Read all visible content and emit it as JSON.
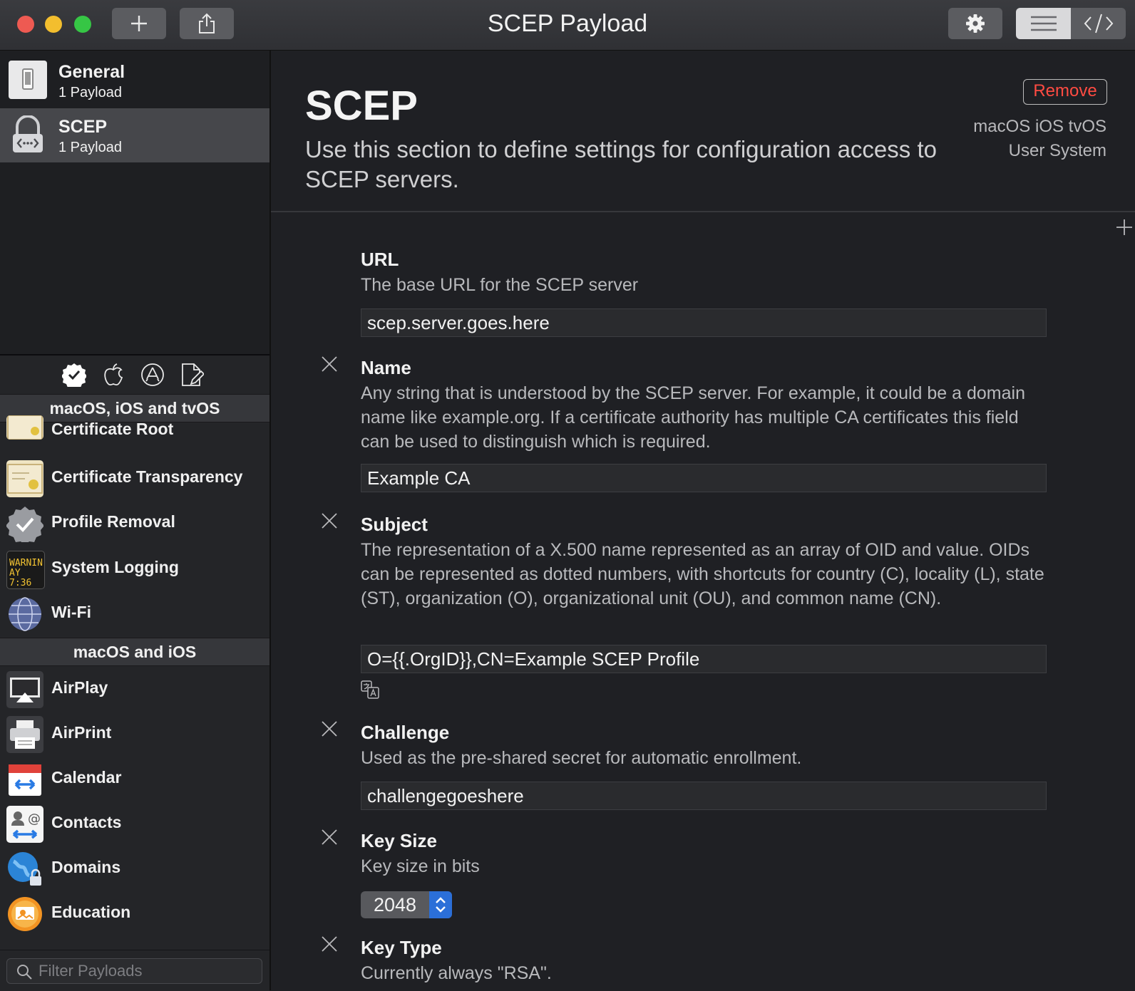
{
  "window": {
    "title": "SCEP Payload"
  },
  "toolbar": {
    "icons": [
      "plus-icon",
      "share-icon",
      "gear-icon",
      "list-view-icon",
      "code-view-icon"
    ]
  },
  "sidebar": {
    "payloads": [
      {
        "title": "General",
        "subtitle": "1 Payload",
        "icon": "device-icon",
        "selected": false
      },
      {
        "title": "SCEP",
        "subtitle": "1 Payload",
        "icon": "scep-lock-icon",
        "selected": true
      }
    ],
    "filter_icons": [
      "checkmark-badge-icon",
      "apple-icon",
      "app-store-icon",
      "document-edit-icon"
    ],
    "groups": [
      {
        "header": "macOS, iOS and tvOS",
        "items": [
          {
            "label": "Certificate Root",
            "icon": "certificate-icon"
          },
          {
            "label": "Certificate Transparency",
            "icon": "certificate-icon"
          },
          {
            "label": "Profile Removal",
            "icon": "badge-check-icon"
          },
          {
            "label": "System Logging",
            "icon": "console-log-icon"
          },
          {
            "label": "Wi-Fi",
            "icon": "globe-icon"
          }
        ]
      },
      {
        "header": "macOS and iOS",
        "items": [
          {
            "label": "AirPlay",
            "icon": "airplay-icon"
          },
          {
            "label": "AirPrint",
            "icon": "printer-icon"
          },
          {
            "label": "Calendar",
            "icon": "calendar-icon"
          },
          {
            "label": "Contacts",
            "icon": "contacts-icon"
          },
          {
            "label": "Domains",
            "icon": "globe-lock-icon"
          },
          {
            "label": "Education",
            "icon": "education-icon"
          }
        ]
      }
    ],
    "console_icon_text": [
      "WARNIN",
      "AY 7:36"
    ],
    "search": {
      "placeholder": "Filter Payloads"
    }
  },
  "main": {
    "title": "SCEP",
    "description": "Use this section to define settings for configuration access to SCEP servers.",
    "remove_label": "Remove",
    "platforms": "macOS iOS tvOS",
    "scope": "User System",
    "fields": [
      {
        "title": "URL",
        "description": "The base URL for the SCEP server",
        "value": "scep.server.goes.here",
        "removable": false
      },
      {
        "title": "Name",
        "description": "Any string that is understood by the SCEP server. For example, it could be a domain name like example.org. If a certificate authority has multiple CA certificates this field can be used to distinguish which is required.",
        "value": "Example CA",
        "removable": true
      },
      {
        "title": "Subject",
        "description": "The representation of a X.500 name represented as an array of OID and value. OIDs can be represented as dotted numbers, with shortcuts for country (C), locality (L), state (ST), organization (O), organizational unit (OU), and common name (CN).",
        "value": "O={{.OrgID}},CN=Example SCEP Profile",
        "removable": true
      },
      {
        "title": "Challenge",
        "description": "Used as the pre-shared secret for automatic enrollment.",
        "value": "challengegoeshere",
        "removable": true
      },
      {
        "title": "Key Size",
        "description": "Key size in bits",
        "value": "2048",
        "removable": true
      },
      {
        "title": "Key Type",
        "description": "Currently always \"RSA\".",
        "removable": true
      }
    ]
  },
  "colors": {
    "accent": "#2b6fd8",
    "remove": "#ff4b42",
    "selected_row": "#46474b"
  }
}
